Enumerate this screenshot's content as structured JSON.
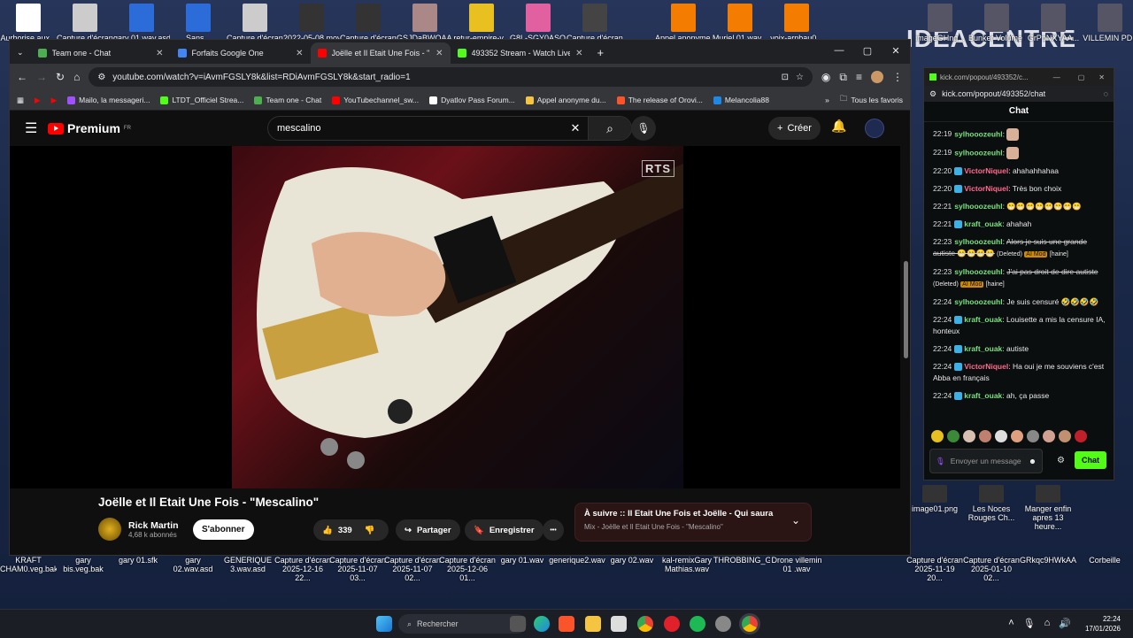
{
  "desktop": {
    "top_icons": [
      "Aurhorise aux...",
      "Capture d'écran...",
      "gary 01.wav.asd",
      "Sans...",
      "Capture d'écran...",
      "2022-05-08 mov...",
      "Capture d'écran...",
      "GSJDaBWOAA...",
      "retur-empire-v...",
      "G8L-SGY0ASO...",
      "Capture d'écran...",
      "Appel anonyme...",
      "Muriel 01.wav...",
      "voix-arnbau0..."
    ],
    "right_icons": [
      "imageGHng...",
      "Bunker Volume Rap 8 Zendo...",
      "GrPpNXYAA...",
      "VILLEMIN PDF"
    ],
    "brand_text": "IDEACENTRE",
    "bottom_icons": [
      "KRAFT CHAM0.veg.bak",
      "gary bis.veg.bak",
      "gary 01.sfk",
      "gary 02.wav.asd",
      "GENERIQUE 3.wav.asd",
      "Capture d'écran 2025-12-16 22...",
      "Capture d'écran 2025-11-07 03...",
      "Capture d'écran 2025-11-07 02...",
      "Capture d'écran 2025-12-06 01...",
      "gary 01.wav",
      "generique2.wav",
      "gary 02.wav",
      "kal-remixGary Mathias.wav",
      "THROBBING_G...",
      "Drone villemin 01 .wav",
      "Capture d'écran 2025-11-19 20...",
      "Capture d'écran 2025-01-10 02...",
      "GRkqc9HWkAA...",
      "Corbeille"
    ],
    "right_mid_icons": [
      "image01.png",
      "Les Noces Rouges Ch...",
      "Manger enfin apres 13 heure..."
    ]
  },
  "browser": {
    "tabs": [
      {
        "label": "Team one - Chat",
        "color": "#4caf50"
      },
      {
        "label": "Forfaits Google One",
        "color": "#4285f4"
      },
      {
        "label": "Joëlle et Il Etait Une Fois - \"Mes",
        "color": "#ff0000"
      },
      {
        "label": "493352 Stream - Watch Live on",
        "color": "#53fc18"
      }
    ],
    "new_tab": "+",
    "url": "youtube.com/watch?v=iAvmFGSLY8k&list=RDiAvmFGSLY8k&start_radio=1",
    "bookmarks": [
      "Mailo, la messageri...",
      "LTDT_Officiel Strea...",
      "Team one - Chat",
      "YouTubechannel_sw...",
      "Dyatlov Pass Forum...",
      "Appel anonyme du...",
      "The release of Orovi...",
      "Melancolia88"
    ],
    "bookmarks_more": "»",
    "all_favorites": "Tous les favoris"
  },
  "youtube": {
    "logo": "Premium",
    "region": "FR",
    "search_query": "mescalino",
    "create_label": "Créer",
    "video_overlay": "RTS",
    "video_title": "Joëlle et Il Etait Une Fois - \"Mescalino\"",
    "channel_name": "Rick Martin",
    "subscribers": "4,68 k abonnés",
    "subscribe_label": "S'abonner",
    "likes": "339",
    "share_label": "Partager",
    "save_label": "Enregistrer",
    "more_label": "•••",
    "next_title": "À suivre :: Il Etait Une Fois et Joëlle - Qui saura",
    "next_sub": "Mix - Joëlle et Il Etait Une Fois - \"Mescalino\""
  },
  "kick": {
    "window_title": "kick.com/popout/493352/c...",
    "url": "kick.com/popout/493352/chat",
    "header": "Chat",
    "messages": [
      {
        "time": "22:19",
        "user": "sylhooozeuhl",
        "cls": "u-g",
        "text": ""
      },
      {
        "time": "22:19",
        "user": "sylhooozeuhl",
        "cls": "u-g",
        "text": ""
      },
      {
        "time": "22:20",
        "user": "VictorNiquel",
        "cls": "u-p",
        "text": "ahahahhahaa"
      },
      {
        "time": "22:20",
        "user": "VictorNiquel",
        "cls": "u-p",
        "text": "Très bon choix"
      },
      {
        "time": "22:21",
        "user": "sylhooozeuhl",
        "cls": "u-g",
        "text": "😁😁😁😁😁😁😁😁"
      },
      {
        "time": "22:21",
        "user": "kraft_ouak",
        "cls": "u-g",
        "text": "ahahah"
      },
      {
        "time": "22:23",
        "user": "sylhooozeuhl",
        "cls": "u-g",
        "text": "Alors je suis une grande autiste 😁😁😁😁",
        "deleted": true,
        "note": "(Deleted)",
        "mod": "AI Mod",
        "tag": "[haine]"
      },
      {
        "time": "22:23",
        "user": "sylhooozeuhl",
        "cls": "u-g",
        "text": "J'ai pas droit de dire autiste",
        "deleted": true,
        "note": "(Deleted)",
        "mod": "AI Mod",
        "tag": "[haine]"
      },
      {
        "time": "22:24",
        "user": "sylhooozeuhl",
        "cls": "u-g",
        "text": "Je suis censuré 🤣🤣🤣🤣"
      },
      {
        "time": "22:24",
        "user": "kraft_ouak",
        "cls": "u-g",
        "text": "Louisette a mis la censure IA, honteux"
      },
      {
        "time": "22:24",
        "user": "kraft_ouak",
        "cls": "u-g",
        "text": "autiste"
      },
      {
        "time": "22:24",
        "user": "VictorNiquel",
        "cls": "u-p",
        "text": "Ha oui je me souviens c'est Abba en français"
      },
      {
        "time": "22:24",
        "user": "kraft_ouak",
        "cls": "u-g",
        "text": "ah, ça passe"
      }
    ],
    "input_placeholder": "Envoyer un message",
    "send_label": "Chat"
  },
  "taskbar": {
    "search": "Rechercher",
    "time": "22:24",
    "date": "17/01/2026"
  }
}
